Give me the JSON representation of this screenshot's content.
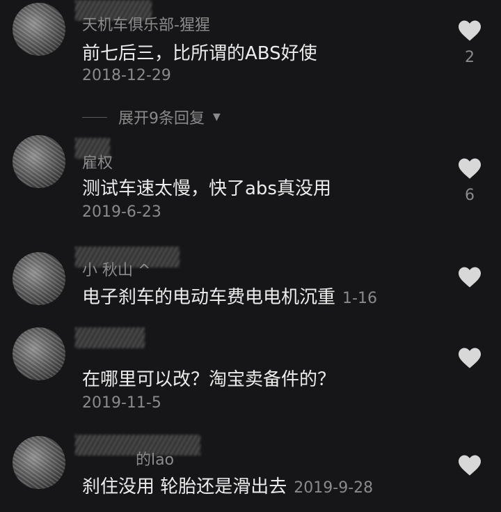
{
  "comments": [
    {
      "username": "天机车俱乐部-猩猩",
      "text": "前七后三，比所谓的ABS好使",
      "date": "2018-12-29",
      "likes": "2"
    },
    {
      "username": "雇权",
      "text": "测试车速太慢，快了abs真没用",
      "date": "2019-6-23",
      "likes": "6"
    },
    {
      "username": "小 秋山 ^",
      "text": "电子刹车的电动车费电电机沉重",
      "date": "1-16",
      "likes": ""
    },
    {
      "username": "",
      "text": "在哪里可以改？淘宝卖备件的？",
      "date": "2019-11-5",
      "likes": ""
    },
    {
      "username": "的lao",
      "text": "刹住没用 轮胎还是滑出去",
      "date": "2019-9-28",
      "likes": ""
    }
  ],
  "expand_replies": {
    "label": "展开9条回复"
  },
  "icons": {
    "like": "heart-icon",
    "expand": "triangle-down-icon"
  },
  "colors": {
    "background": "#161618",
    "text": "#ececec",
    "secondary": "#8a8a8a",
    "heart": "#d8d8d8"
  }
}
